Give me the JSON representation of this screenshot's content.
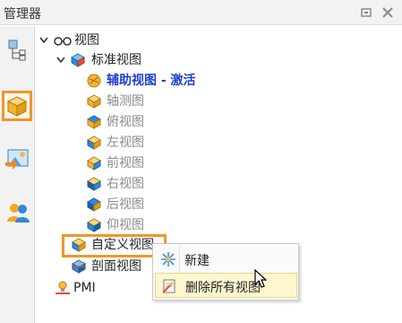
{
  "panel": {
    "title": "管理器"
  },
  "tree": {
    "root": {
      "label": "视图"
    },
    "standard": {
      "label": "标准视图"
    },
    "views": [
      {
        "label": "辅助视图 - 激活",
        "state": "active"
      },
      {
        "label": "轴测图",
        "state": "muted"
      },
      {
        "label": "俯视图",
        "state": "muted"
      },
      {
        "label": "左视图",
        "state": "muted"
      },
      {
        "label": "前视图",
        "state": "muted"
      },
      {
        "label": "右视图",
        "state": "muted"
      },
      {
        "label": "后视图",
        "state": "muted"
      },
      {
        "label": "仰视图",
        "state": "muted"
      }
    ],
    "custom": {
      "label": "自定义视图"
    },
    "section": {
      "label": "剖面视图"
    },
    "pmi": {
      "label": "PMI"
    }
  },
  "context_menu": {
    "items": [
      {
        "label": "新建",
        "icon": "sparkle-new-icon"
      },
      {
        "label": "删除所有视图",
        "icon": "delete-views-icon"
      }
    ]
  },
  "colors": {
    "accent": "#f0962b",
    "active_text": "#1d3fd0",
    "muted_text": "#8a8a8a"
  }
}
